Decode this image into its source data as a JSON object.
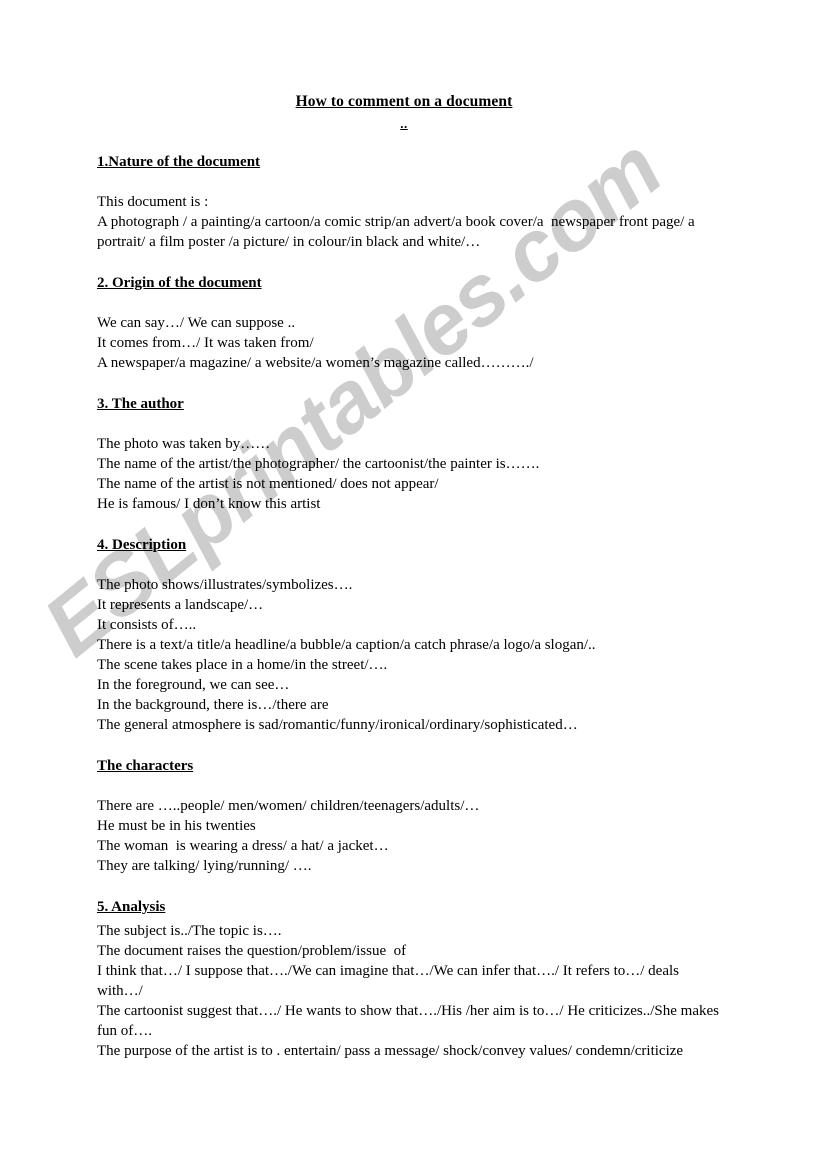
{
  "document": {
    "title": "How to comment on a document",
    "title_mark": "..",
    "watermark": "ESLprintables.com",
    "watermark_color": "#cdcdcd"
  },
  "sections": [
    {
      "heading": "1.Nature of the document",
      "lines": [
        "This document is :",
        "A photograph / a painting/a cartoon/a comic strip/an advert/a book cover/a  newspaper front page/ a portrait/ a film poster /a picture/ in colour/in black and white/…"
      ]
    },
    {
      "heading": "2. Origin of the document",
      "lines": [
        "We can say…/ We can suppose ..",
        "It comes from…/ It was taken from/",
        "A newspaper/a magazine/ a website/a women’s magazine called………./"
      ]
    },
    {
      "heading": "3. The author",
      "lines": [
        "The photo was taken by……",
        "The name of the artist/the photographer/ the cartoonist/the painter is…….",
        "The name of the artist is not mentioned/ does not appear/",
        "He is famous/ I don’t know this artist"
      ]
    },
    {
      "heading": "4. Description",
      "lines": [
        "The photo shows/illustrates/symbolizes….",
        "It represents a landscape/…",
        "It consists of…..",
        "There is a text/a title/a headline/a bubble/a caption/a catch phrase/a logo/a slogan/..",
        "The scene takes place in a home/in the street/….",
        "In the foreground, we can see…",
        "In the background, there is…/there are",
        "The general atmosphere is sad/romantic/funny/ironical/ordinary/sophisticated…"
      ]
    },
    {
      "heading": "The characters",
      "lines": [
        "There are …..people/ men/women/ children/teenagers/adults/…",
        "He must be in his twenties",
        "The woman  is wearing a dress/ a hat/ a jacket…",
        "They are talking/ lying/running/ …."
      ]
    },
    {
      "heading": "5. Analysis",
      "lines": [
        "The subject is../The topic is….",
        "The document raises the question/problem/issue  of",
        "I think that…/ I suppose that…./We can imagine that…/We can infer that…./ It refers to…/ deals with…/",
        "The cartoonist suggest that…./ He wants to show that…./His /her aim is to…/ He criticizes../She makes fun of….",
        "The purpose of the artist is to . entertain/ pass a message/ shock/convey values/ condemn/criticize"
      ]
    }
  ]
}
